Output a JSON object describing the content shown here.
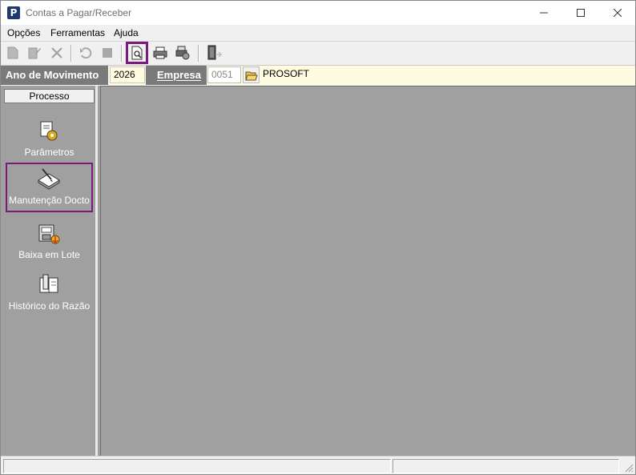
{
  "window": {
    "title": "Contas a Pagar/Receber",
    "app_icon_letter": "P"
  },
  "menu": {
    "items": [
      "Opções",
      "Ferramentas",
      "Ajuda"
    ]
  },
  "toolbar": {
    "buttons": [
      "new-document-icon",
      "edit-document-icon",
      "delete-icon",
      "undo-icon",
      "stop-icon",
      "print-preview-icon",
      "print-icon",
      "printer-settings-icon",
      "exit-door-icon"
    ]
  },
  "infobar": {
    "year_label": "Ano de Movimento",
    "year_value": "2026",
    "company_label": "Empresa",
    "company_code": "0051",
    "company_name": "PROSOFT"
  },
  "sidebar": {
    "header": "Processo",
    "items": [
      {
        "label": "Parâmetros",
        "icon": "parameters-icon"
      },
      {
        "label": "Manutenção Docto",
        "icon": "document-maintenance-icon"
      },
      {
        "label": "Baixa em Lote",
        "icon": "batch-write-off-icon"
      },
      {
        "label": "Histórico do Razão",
        "icon": "ledger-history-icon"
      }
    ]
  },
  "colors": {
    "accent_highlight": "#7a1a7a",
    "mdi_background": "#a0a0a0",
    "infobar_background": "#fffbe0"
  }
}
